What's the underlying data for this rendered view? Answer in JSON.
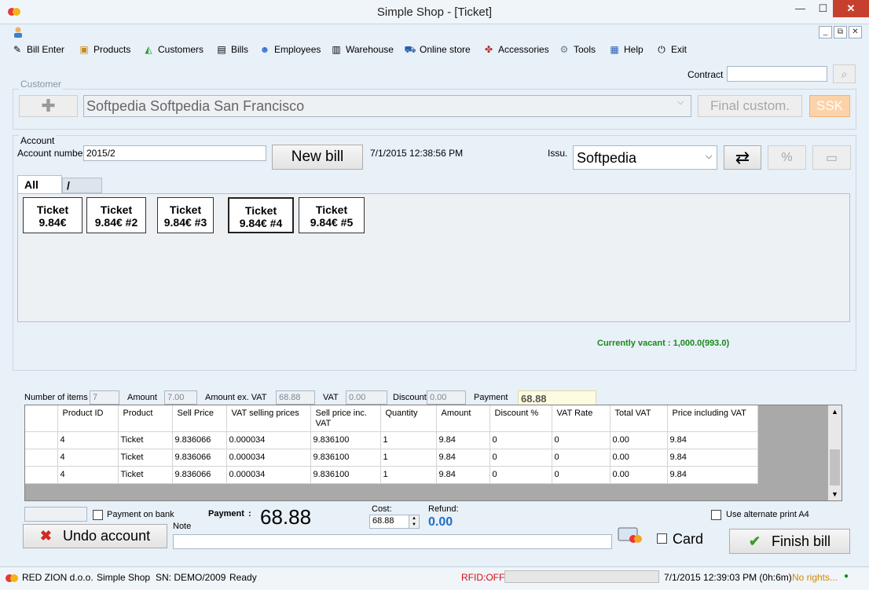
{
  "window": {
    "title": "Simple Shop - [Ticket]",
    "minimize": "—",
    "maximize": "☐",
    "close": "✕"
  },
  "mdi": {
    "minimize": "_",
    "restore": "⧉",
    "close": "✕"
  },
  "menu": [
    {
      "label": "Bill Enter",
      "icon": "pencil-icon"
    },
    {
      "label": "Products",
      "icon": "box-icon"
    },
    {
      "label": "Customers",
      "icon": "handshake-icon"
    },
    {
      "label": "Bills",
      "icon": "document-icon"
    },
    {
      "label": "Employees",
      "icon": "people-icon"
    },
    {
      "label": "Warehouse",
      "icon": "clipboard-icon"
    },
    {
      "label": "Online store",
      "icon": "cart-icon"
    },
    {
      "label": "Accessories",
      "icon": "tools-icon"
    },
    {
      "label": "Tools",
      "icon": "wrench-icon"
    },
    {
      "label": "Help",
      "icon": "help-icon"
    },
    {
      "label": "Exit",
      "icon": "power-icon"
    }
  ],
  "customer": {
    "group_label": "Customer",
    "contract_label": "Contract",
    "contract_value": "",
    "name": "Softpedia Softpedia San Francisco",
    "final_button": "Final custom.",
    "ssk_button": "SSK"
  },
  "account": {
    "group_label": "Account",
    "number_label": "Account number",
    "number_value": "2015/2",
    "new_bill_button": "New bill",
    "datetime": "7/1/2015 12:38:56 PM",
    "issuer_label": "Issu.",
    "issuer_value": "Softpedia"
  },
  "tabs": [
    {
      "label": "All"
    },
    {
      "label": "/"
    }
  ],
  "tickets": [
    {
      "line1": "Ticket",
      "line2": "9.84€"
    },
    {
      "line1": "Ticket",
      "line2": "9.84€ #2"
    },
    {
      "line1": "Ticket",
      "line2": "9.84€ #3"
    },
    {
      "line1": "Ticket",
      "line2": "9.84€ #4"
    },
    {
      "line1": "Ticket",
      "line2": "9.84€ #5"
    }
  ],
  "vacant": "Currently vacant : 1,000.0(993.0)",
  "summary": {
    "items_label": "Number of items",
    "items_value": "7",
    "amount_label": "Amount",
    "amount_value": "7.00",
    "exvat_label": "Amount ex. VAT",
    "exvat_value": "68.88",
    "vat_label": "VAT",
    "vat_value": "0.00",
    "discount_label": "Discount",
    "discount_value": "0.00",
    "payment_label": "Payment",
    "payment_value": "68.88"
  },
  "grid": {
    "columns": [
      "Product ID",
      "Product",
      "Sell Price",
      "VAT selling prices",
      "Sell price inc. VAT",
      "Quantity",
      "Amount",
      "Discount %",
      "VAT Rate",
      "Total VAT",
      "Price including VAT"
    ],
    "rows": [
      [
        "4",
        "Ticket",
        "9.836066",
        "0.000034",
        "9.836100",
        "1",
        "9.84",
        "0",
        "0",
        "0.00",
        "9.84"
      ],
      [
        "4",
        "Ticket",
        "9.836066",
        "0.000034",
        "9.836100",
        "1",
        "9.84",
        "0",
        "0",
        "0.00",
        "9.84"
      ],
      [
        "4",
        "Ticket",
        "9.836066",
        "0.000034",
        "9.836100",
        "1",
        "9.84",
        "0",
        "0",
        "0.00",
        "9.84"
      ]
    ]
  },
  "bottom": {
    "payment_on_bank": "Payment on bank",
    "payment_label": "Payment",
    "payment_value": "68.88",
    "cost_label": "Cost:",
    "cost_value": "68.88",
    "refund_label": "Refund:",
    "refund_value": "0.00",
    "use_alt_print": "Use alternate print A4",
    "note_label": "Note",
    "undo_button": "Undo account",
    "card_label": "Card",
    "finish_button": "Finish bill"
  },
  "status": {
    "company": "RED ZION d.o.o.",
    "app": "Simple Shop",
    "serial": "SN:  DEMO/2009",
    "state": "Ready",
    "rfid": "RFID:OFF",
    "clock": "7/1/2015 12:39:03 PM (0h:6m)",
    "rights": "No rights...",
    "dot": "●"
  },
  "colors": {
    "vacant": "#1a8a1a",
    "refund": "#1f6fc8",
    "rfid": "#d01010",
    "rights": "#d08a00",
    "payment_bg": "#fdfbe0"
  }
}
